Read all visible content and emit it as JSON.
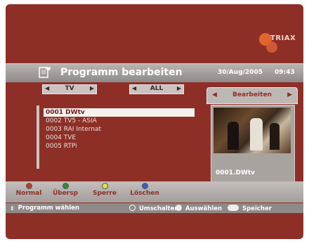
{
  "logo": {
    "text": "TRIAX"
  },
  "header": {
    "title": "Programm bearbeiten",
    "date": "30/Aug/2005",
    "time": "09:43",
    "icon": "edit-icon"
  },
  "filters": {
    "group": "TV",
    "category": "ALL"
  },
  "panel": {
    "label": "Bearbeiten"
  },
  "list": {
    "items": [
      {
        "label": "0001 DWtv"
      },
      {
        "label": "0002 TV5 - ASIA"
      },
      {
        "label": "0003 RAI Internat"
      },
      {
        "label": "0004 TVE"
      },
      {
        "label": "0005 RTPi"
      }
    ]
  },
  "preview": {
    "label": "0001.DWtv"
  },
  "colorkeys": [
    {
      "label": "Normal",
      "color": "#c0392b"
    },
    {
      "label": "Übersp",
      "color": "#2e8b3a"
    },
    {
      "label": "Sperre",
      "color": "#e5e039"
    },
    {
      "label": "Löschen",
      "color": "#3b5bc9"
    }
  ],
  "help": {
    "select": "Programm wählen",
    "switch": "Umschalten",
    "ok_key": "OK",
    "choose": "Auswählen",
    "menu_key": "Menu",
    "save": "Speicher"
  }
}
